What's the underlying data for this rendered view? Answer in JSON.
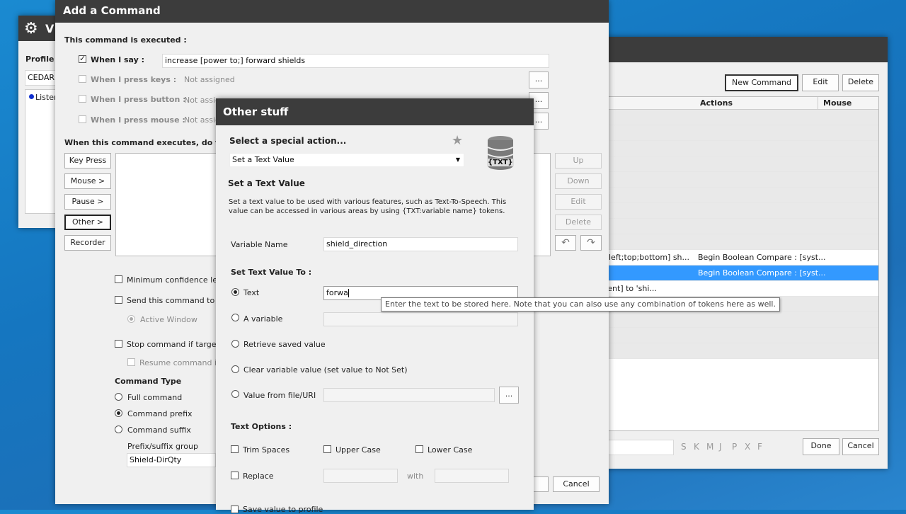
{
  "bg_window": {
    "title_partial": "V",
    "profile_label": "Profile :",
    "profile_value": "CEDAR",
    "listening_item": "Lister"
  },
  "cmd_list_window": {
    "buttons": {
      "new_command": "New Command",
      "edit": "Edit",
      "delete": "Delete"
    },
    "headers": {
      "actions": "Actions",
      "mouse": "Mouse"
    },
    "rows": [
      {
        "text": "",
        "actions": ""
      },
      {
        "text": "",
        "actions": ""
      },
      {
        "text": "",
        "actions": ""
      },
      {
        "text": "",
        "actions": ""
      },
      {
        "text": "",
        "actions": ""
      },
      {
        "text": "",
        "actions": ""
      },
      {
        "text": "",
        "actions": ""
      },
      {
        "text": "",
        "actions": ""
      },
      {
        "text": "",
        "actions": ""
      },
      {
        "text": "nt;left;top;bottom] sh...",
        "actions": "Begin Boolean Compare : [syst..."
      },
      {
        "text": "",
        "actions": "Begin Boolean Compare : [syst..."
      },
      {
        "text": "event] to 'shi...",
        "actions": ""
      },
      {
        "text": "",
        "actions": ""
      },
      {
        "text": "",
        "actions": ""
      },
      {
        "text": "",
        "actions": ""
      },
      {
        "text": "",
        "actions": ""
      }
    ],
    "filter_letters": [
      "S",
      "K",
      "M",
      "J",
      "P",
      "X",
      "F"
    ],
    "done": "Done",
    "cancel": "Cancel"
  },
  "add_command": {
    "title": "Add a Command",
    "executed_label": "This command is executed :",
    "when_i_say": "When I say :",
    "when_i_say_value": "increase [power to;] forward shields",
    "when_press_keys": "When I press keys :",
    "when_press_button": "When I press button :",
    "when_press_mouse": "When I press mouse :",
    "not_assigned": "Not assigned",
    "not_assigned_partial": "Not assig",
    "ellipsis": "...",
    "executes_label": "When this command executes, do the fol",
    "side_buttons": [
      "Key Press",
      "Mouse >",
      "Pause >",
      "Other >",
      "Recorder"
    ],
    "right_buttons": [
      "Up",
      "Down",
      "Edit",
      "Delete"
    ],
    "min_confidence": "Minimum confidence lev",
    "send_command": "Send this command to",
    "active_window": "Active Window",
    "stop_command": "Stop command if target",
    "resume_command": "Resume command if",
    "command_type": "Command Type",
    "full_command": "Full command",
    "command_prefix": "Command prefix",
    "command_suffix": "Command suffix",
    "prefix_group": "Prefix/suffix group",
    "prefix_group_value": "Shield-DirQty",
    "cancel": "Cancel"
  },
  "other_stuff": {
    "title": "Other stuff",
    "select_action": "Select a special action...",
    "action_value": "Set a Text Value",
    "section_title": "Set a Text Value",
    "description": "Set a text value to be used with various features, such as Text-To-Speech.  This value can be accessed in various areas by using {TXT:variable name} tokens.",
    "variable_name_label": "Variable Name",
    "variable_name_value": "shield_direction",
    "set_value_to": "Set Text Value To :",
    "opt_text": "Text",
    "text_value": "forwa",
    "opt_variable": "A variable",
    "opt_retrieve": "Retrieve saved value",
    "opt_clear": "Clear variable value (set value to Not Set)",
    "opt_file": "Value from file/URI",
    "ellipsis": "...",
    "text_options": "Text Options :",
    "trim": "Trim Spaces",
    "upper": "Upper Case",
    "lower": "Lower Case",
    "replace": "Replace",
    "with": "with",
    "save_partial": "Save value to profile",
    "db_badge": "{TXT}"
  },
  "tooltip": "Enter the text to be stored here.  Note that you can also use any combination of tokens here as well."
}
